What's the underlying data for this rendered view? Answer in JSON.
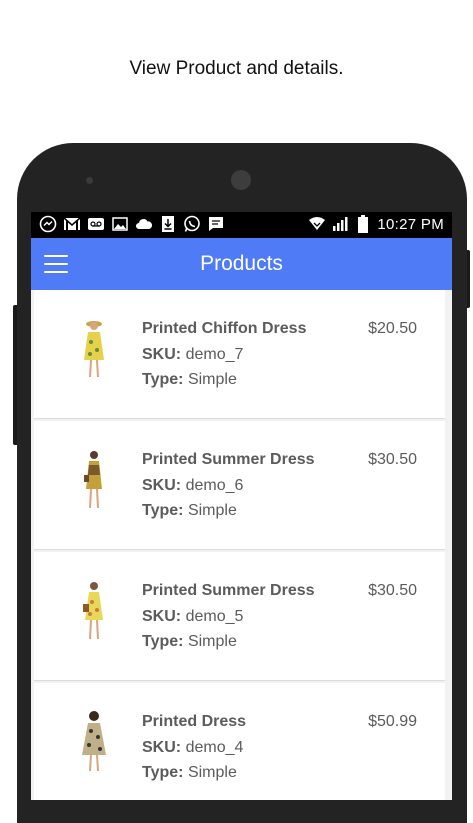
{
  "caption": "View Product and details.",
  "status_bar": {
    "time": "10:27 PM",
    "left_icons": [
      "messenger-icon",
      "gmail-icon",
      "voicemail-icon",
      "gallery-icon",
      "cloud-icon",
      "download-icon",
      "whatsapp-icon",
      "message-icon"
    ],
    "right_icons": [
      "wifi-icon",
      "signal-icon",
      "battery-icon"
    ]
  },
  "app_bar": {
    "title": "Products",
    "menu_icon": "hamburger-menu-icon",
    "color": "#4f7cf6"
  },
  "labels": {
    "sku": "SKU:",
    "type": "Type:"
  },
  "products": [
    {
      "name": "Printed Chiffon Dress",
      "price": "$20.50",
      "sku": "demo_7",
      "type": "Simple"
    },
    {
      "name": "Printed Summer Dress",
      "price": "$30.50",
      "sku": "demo_6",
      "type": "Simple"
    },
    {
      "name": "Printed Summer Dress",
      "price": "$30.50",
      "sku": "demo_5",
      "type": "Simple"
    },
    {
      "name": "Printed Dress",
      "price": "$50.99",
      "sku": "demo_4",
      "type": "Simple"
    }
  ]
}
